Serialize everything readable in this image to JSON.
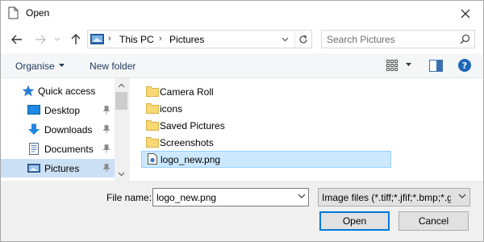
{
  "window": {
    "title": "Open",
    "close_glyph": "✕"
  },
  "nav": {
    "back_glyph": "←",
    "forward_glyph": "→",
    "recent_glyph": "⌄",
    "up_glyph": "↑"
  },
  "address": {
    "segments": [
      "This PC",
      "Pictures"
    ],
    "chevron": "›"
  },
  "search": {
    "placeholder": "Search Pictures"
  },
  "toolbar": {
    "organise_label": "Organise",
    "new_folder_label": "New folder",
    "help_label": "?"
  },
  "sidebar": {
    "items": [
      {
        "label": "Quick access",
        "icon": "star-icon",
        "pinned": false
      },
      {
        "label": "Desktop",
        "icon": "desktop-icon",
        "pinned": true
      },
      {
        "label": "Downloads",
        "icon": "download-icon",
        "pinned": true
      },
      {
        "label": "Documents",
        "icon": "documents-icon",
        "pinned": true
      },
      {
        "label": "Pictures",
        "icon": "pictures-icon",
        "pinned": true,
        "selected": true
      }
    ]
  },
  "files": [
    {
      "name": "Camera Roll",
      "type": "folder"
    },
    {
      "name": "icons",
      "type": "folder"
    },
    {
      "name": "Saved Pictures",
      "type": "folder"
    },
    {
      "name": "Screenshots",
      "type": "folder"
    },
    {
      "name": "logo_new.png",
      "type": "png",
      "selected": true
    }
  ],
  "bottom": {
    "file_name_label": "File name:",
    "file_name_value": "logo_new.png",
    "file_type_value": "Image files (*.tiff;*.jfif;*.bmp;*.gif;*.png)",
    "open_label": "Open",
    "cancel_label": "Cancel"
  },
  "colors": {
    "accent": "#0078d7",
    "folder_yellow": "#f8d775",
    "selection": "#cce8ff",
    "nav_selection": "#cce0f5"
  }
}
